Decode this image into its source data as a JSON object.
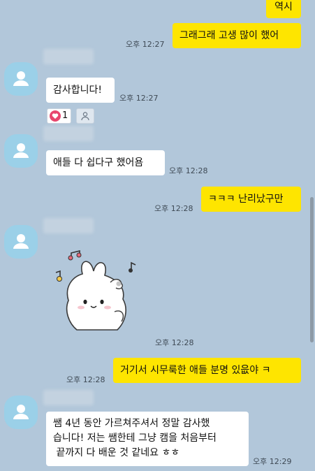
{
  "colors": {
    "background": "#b2c7da",
    "my_bubble": "#fee500",
    "their_bubble": "#ffffff",
    "avatar": "#9bd0e8"
  },
  "messages": {
    "m1": {
      "text": "역시"
    },
    "m2": {
      "text": "그래그래 고생 많이 했어",
      "time": "오후 12:27"
    },
    "m3": {
      "text": "감사합니다!",
      "time": "오후 12:27",
      "reaction_icon": "heart-icon",
      "reaction_count": "1"
    },
    "m4": {
      "text": "애들 다 쉽다구 했어욤",
      "time": "오후 12:28"
    },
    "m5": {
      "text": "ㅋㅋㅋ 난리났구만",
      "time": "오후 12:28"
    },
    "m6": {
      "sticker": "bunny-sticker-with-music-notes",
      "time": "오후 12:28"
    },
    "m7": {
      "text": "거기서 시무룩한 애들 분명 있읎야 ㅋ",
      "time": "오후 12:28"
    },
    "m8": {
      "line1": "쌤 4년 동안 가르쳐주셔서 정말 감사했",
      "line2": "습니다! 저는 쌤한테 그냥 캠을 처음부터",
      "line3": " 끝까지 다 배운 것 같네요 ㅎㅎ",
      "time": "오후 12:29"
    }
  }
}
